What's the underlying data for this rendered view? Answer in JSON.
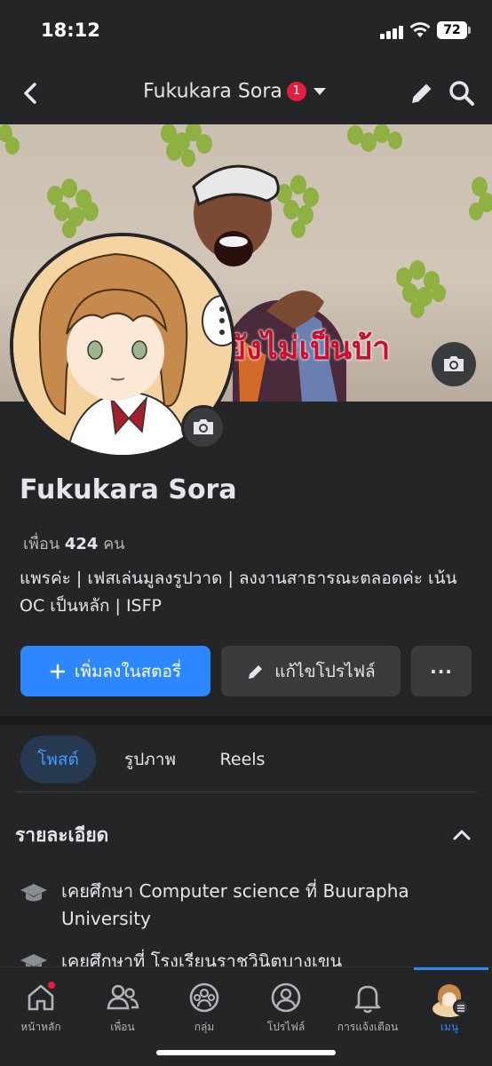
{
  "status_bar": {
    "time": "18:12",
    "battery": "72"
  },
  "header": {
    "title": "Fukukara Sora",
    "notification_count": "1"
  },
  "cover": {
    "caption": "ยังไม่เป็นบ้า"
  },
  "profile": {
    "name": "Fukukara Sora",
    "friends_prefix": "เพื่อน",
    "friends_count": "424",
    "friends_suffix": "คน",
    "bio": "แพรค่ะ | เฟสเล่นมูลงรูปวาด | ลงงานสาธารณะตลอดค่ะ เน้น OC เป็นหลัก | ISFP"
  },
  "actions": {
    "add_story": "เพิ่มลงในสตอรี่",
    "edit_profile": "แก้ไขโปรไฟล์",
    "more": "···"
  },
  "tabs": [
    {
      "label": "โพสต์",
      "active": true
    },
    {
      "label": "รูปภาพ",
      "active": false
    },
    {
      "label": "Reels",
      "active": false
    }
  ],
  "details": {
    "heading": "รายละเอียด",
    "items": [
      {
        "icon": "education-cap-icon",
        "text": "เคยศึกษา Computer science ที่ Buurapha University"
      },
      {
        "icon": "education-cap-icon",
        "text": "เคยศึกษาที่ โรงเรียนราชวินิตบางเขน"
      }
    ]
  },
  "bottom_nav": [
    {
      "icon": "home-icon",
      "label": "หน้าหลัก",
      "has_badge": true
    },
    {
      "icon": "friends-icon",
      "label": "เพื่อน"
    },
    {
      "icon": "groups-icon",
      "label": "กลุ่ม"
    },
    {
      "icon": "profile-icon",
      "label": "โปรไฟล์"
    },
    {
      "icon": "bell-icon",
      "label": "การแจ้งเตือน"
    },
    {
      "icon": "menu-avatar-icon",
      "label": "เมนู",
      "active": true
    }
  ],
  "colors": {
    "accent": "#2d88ff",
    "background": "#242526",
    "badge": "#e41e3f",
    "active_tab_bg": "#263951"
  }
}
